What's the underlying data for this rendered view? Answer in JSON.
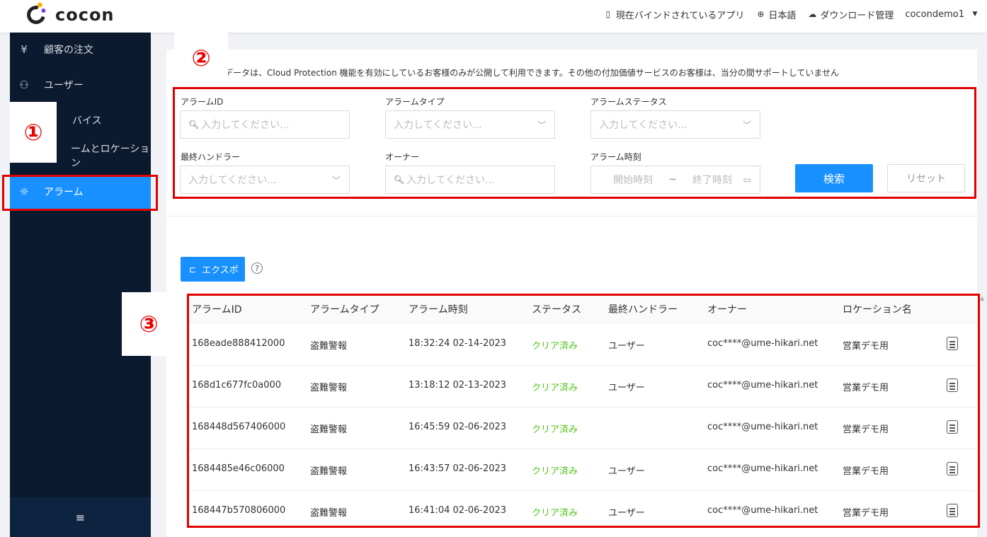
{
  "header": {
    "logo_text": "cocon",
    "bound_app": "現在バインドされているアプリ",
    "language": "日本語",
    "download": "ダウンロード管理",
    "user": "cocondemo1"
  },
  "sidebar": {
    "items": [
      {
        "label": "顧客の注文",
        "icon": "receipt-icon"
      },
      {
        "label": "ユーザー",
        "icon": "users-icon"
      },
      {
        "label": "バイス",
        "icon": "device-icon"
      },
      {
        "label": "ームとロケーション",
        "icon": "home-icon"
      },
      {
        "label": "アラーム",
        "icon": "alarm-icon"
      }
    ],
    "collapse_icon": "≡"
  },
  "annotations": {
    "one": "①",
    "two": "②",
    "three": "③"
  },
  "notice": "データは、Cloud Protection 機能を有効にしているお客様のみが公開して利用できます。その他の付加価値サービスのお客様は、当分の間サポートしていません",
  "filters": {
    "alarm_id": {
      "label": "アラームID",
      "placeholder": "入力してください..."
    },
    "alarm_type": {
      "label": "アラームタイプ",
      "placeholder": "入力してください..."
    },
    "alarm_status": {
      "label": "アラームステータス",
      "placeholder": "入力してください..."
    },
    "last_handler": {
      "label": "最終ハンドラー",
      "placeholder": "入力してください..."
    },
    "owner": {
      "label": "オーナー",
      "placeholder": "入力してください..."
    },
    "alarm_time": {
      "label": "アラーム時刻",
      "start": "開始時刻",
      "tilde": "~",
      "end": "終了時刻"
    },
    "search": "検索",
    "reset": "リセット"
  },
  "export_label": "エクスポ",
  "help": "?",
  "table": {
    "headers": [
      "アラームID",
      "アラームタイプ",
      "アラーム時刻",
      "ステータス",
      "最終ハンドラー",
      "オーナー",
      "ロケーション名"
    ],
    "rows": [
      {
        "id": "168eade888412000",
        "type": "盗難警報",
        "time": "18:32:24 02-14-2023",
        "status": "クリア済み",
        "handler": "ユーザー",
        "owner": "coc****@ume-hikari.net",
        "location": "営業デモ用"
      },
      {
        "id": "168d1c677fc0a000",
        "type": "盗難警報",
        "time": "13:18:12 02-13-2023",
        "status": "クリア済み",
        "handler": "ユーザー",
        "owner": "coc****@ume-hikari.net",
        "location": "営業デモ用"
      },
      {
        "id": "168448d567406000",
        "type": "盗難警報",
        "time": "16:45:59 02-06-2023",
        "status": "クリア済み",
        "handler": "",
        "owner": "coc****@ume-hikari.net",
        "location": "営業デモ用"
      },
      {
        "id": "1684485e46c06000",
        "type": "盗難警報",
        "time": "16:43:57 02-06-2023",
        "status": "クリア済み",
        "handler": "ユーザー",
        "owner": "coc****@ume-hikari.net",
        "location": "営業デモ用"
      },
      {
        "id": "168447b570806000",
        "type": "盗難警報",
        "time": "16:41:04 02-06-2023",
        "status": "クリア済み",
        "handler": "ユーザー",
        "owner": "coc****@ume-hikari.net",
        "location": "営業デモ用"
      }
    ]
  },
  "colors": {
    "accent": "#1890ff",
    "annotation_red": "#e00000",
    "status_green": "#52c41a",
    "sidebar_bg": "#0b1a2e"
  }
}
